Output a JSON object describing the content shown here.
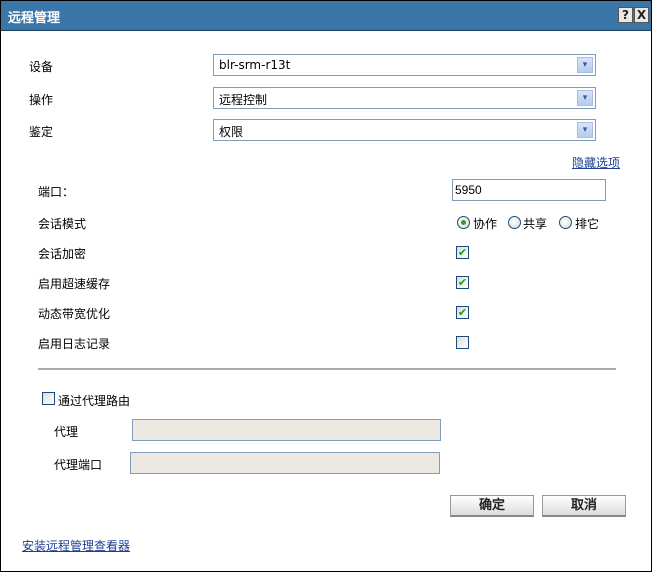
{
  "window": {
    "title": "远程管理",
    "help": "?",
    "close": "X"
  },
  "fields": {
    "device": {
      "label": "设备",
      "value": "blr-srm-r13t"
    },
    "operation": {
      "label": "操作",
      "value": "远程控制"
    },
    "auth": {
      "label": "鉴定",
      "value": "权限"
    }
  },
  "hide_options": "隐藏选项",
  "options": {
    "port": {
      "label": "端口：",
      "value": "5950"
    },
    "session_mode": {
      "label": "会话模式",
      "choices": [
        "协作",
        "共享",
        "排它"
      ],
      "selected": 0
    },
    "encrypt": {
      "label": "会话加密",
      "checked": true
    },
    "cache": {
      "label": "启用超速缓存",
      "checked": true
    },
    "bandwidth": {
      "label": "动态带宽优化",
      "checked": true
    },
    "logging": {
      "label": "启用日志记录",
      "checked": false
    }
  },
  "proxy": {
    "route_label": "通过代理路由",
    "checked": false,
    "proxy_label": "代理",
    "proxy_value": "",
    "port_label": "代理端口",
    "port_value": ""
  },
  "buttons": {
    "ok": "确定",
    "cancel": "取消"
  },
  "install_link": "安装远程管理查看器",
  "check_glyph": "✔",
  "arrow_glyph": "▾"
}
